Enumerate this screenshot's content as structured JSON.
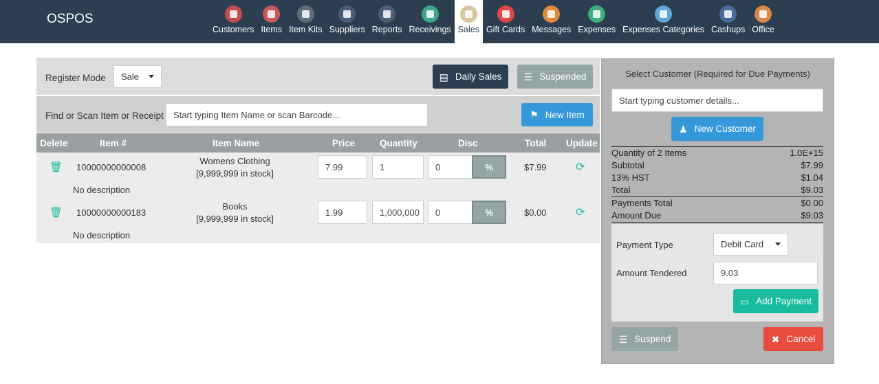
{
  "brand": "OSPOS",
  "nav": [
    {
      "label": "Customers",
      "color": "#c0504d"
    },
    {
      "label": "Items",
      "color": "#c55a5a"
    },
    {
      "label": "Item Kits",
      "color": "#5a6f7a"
    },
    {
      "label": "Suppliers",
      "color": "#4a5d78"
    },
    {
      "label": "Reports",
      "color": "#4b6075"
    },
    {
      "label": "Receivings",
      "color": "#3aa88a"
    },
    {
      "label": "Sales",
      "color": "#d9c4a0"
    },
    {
      "label": "Gift Cards",
      "color": "#e0464a"
    },
    {
      "label": "Messages",
      "color": "#e08a3c"
    },
    {
      "label": "Expenses",
      "color": "#3fae7f"
    },
    {
      "label": "Expenses Categories",
      "color": "#5da8d8"
    },
    {
      "label": "Cashups",
      "color": "#4a6a9a"
    },
    {
      "label": "Office",
      "color": "#d58a4a"
    }
  ],
  "register": {
    "mode_label": "Register Mode",
    "mode_value": "Sale",
    "daily_sales": "Daily Sales",
    "suspended": "Suspended",
    "find_label": "Find or Scan Item or Receipt",
    "find_placeholder": "Start typing Item Name or scan Barcode...",
    "new_item": "New Item"
  },
  "cart": {
    "headers": {
      "delete": "Delete",
      "item_no": "Item #",
      "item_name": "Item Name",
      "price": "Price",
      "quantity": "Quantity",
      "disc": "Disc",
      "total": "Total",
      "update": "Update"
    },
    "rows": [
      {
        "item_no": "10000000000008",
        "name": "Womens Clothing",
        "stock": "[9,999,999 in stock]",
        "price": "7.99",
        "quantity": "1",
        "disc": "0",
        "disc_type": "%",
        "total": "$7.99",
        "description": "No description"
      },
      {
        "item_no": "10000000000183",
        "name": "Books",
        "stock": "[9,999,999 in stock]",
        "price": "1.99",
        "quantity": "1,000,000",
        "disc": "0",
        "disc_type": "%",
        "total": "$0.00",
        "description": "No description"
      }
    ]
  },
  "customer": {
    "title": "Select Customer (Required for Due Payments)",
    "placeholder": "Start typing customer details...",
    "new_customer": "New Customer"
  },
  "summary": {
    "quantity_label": "Quantity of 2 Items",
    "quantity_value": "1.0E+15",
    "subtotal_label": "Subtotal",
    "subtotal_value": "$7.99",
    "tax_label": "13% HST",
    "tax_value": "$1.04",
    "total_label": "Total",
    "total_value": "$9.03",
    "payments_label": "Payments Total",
    "payments_value": "$0.00",
    "due_label": "Amount Due",
    "due_value": "$9.03"
  },
  "payment": {
    "type_label": "Payment Type",
    "type_value": "Debit Card",
    "tendered_label": "Amount Tendered",
    "tendered_value": "9.03",
    "add_payment": "Add Payment",
    "suspend": "Suspend",
    "cancel": "Cancel"
  }
}
